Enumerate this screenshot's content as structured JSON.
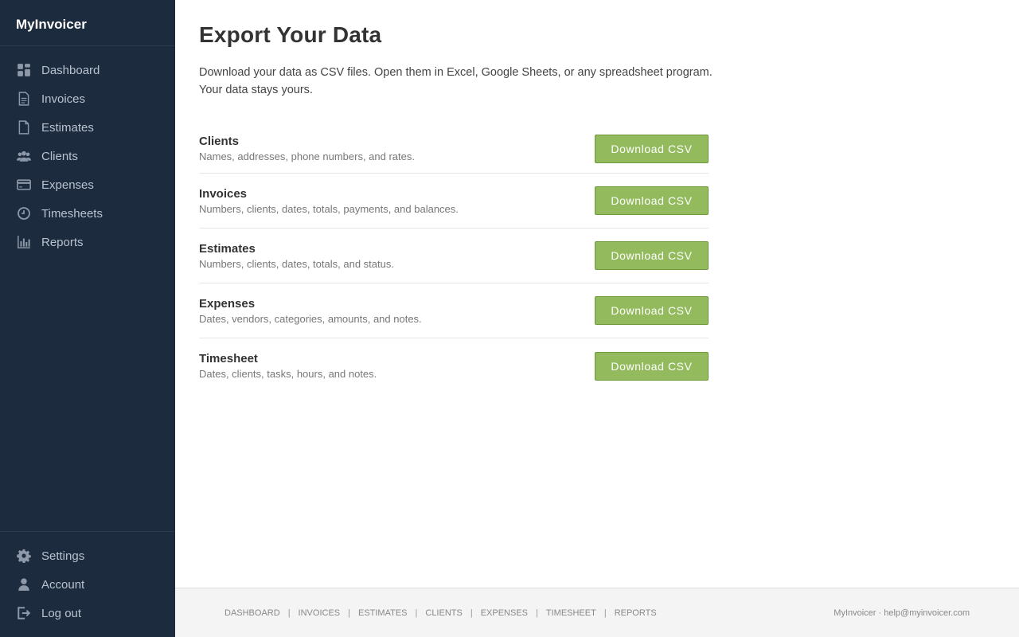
{
  "app": {
    "brand": "MyInvoicer"
  },
  "sidebar": {
    "items": [
      {
        "label": "Dashboard",
        "icon": "dashboard-icon"
      },
      {
        "label": "Invoices",
        "icon": "invoice-icon"
      },
      {
        "label": "Estimates",
        "icon": "estimate-icon"
      },
      {
        "label": "Clients",
        "icon": "clients-icon"
      },
      {
        "label": "Expenses",
        "icon": "credit-card-icon"
      },
      {
        "label": "Timesheets",
        "icon": "clock-icon"
      },
      {
        "label": "Reports",
        "icon": "bar-chart-icon"
      }
    ],
    "bottom_items": [
      {
        "label": "Settings",
        "icon": "gear-icon"
      },
      {
        "label": "Account",
        "icon": "user-icon"
      },
      {
        "label": "Log out",
        "icon": "logout-icon"
      }
    ]
  },
  "main": {
    "title": "Export Your Data",
    "intro_line1": "Download your data as CSV files. Open them in Excel, Google Sheets, or any spreadsheet program.",
    "intro_line2": "Your data stays yours.",
    "exports": [
      {
        "name": "Clients",
        "description": "Names, addresses, phone numbers, and rates.",
        "button": "Download CSV"
      },
      {
        "name": "Invoices",
        "description": "Numbers, clients, dates, totals, payments, and balances.",
        "button": "Download CSV"
      },
      {
        "name": "Estimates",
        "description": "Numbers, clients, dates, totals, and status.",
        "button": "Download CSV"
      },
      {
        "name": "Expenses",
        "description": "Dates, vendors, categories, amounts, and notes.",
        "button": "Download CSV"
      },
      {
        "name": "Timesheet",
        "description": "Dates, clients, tasks, hours, and notes.",
        "button": "Download CSV"
      }
    ]
  },
  "footer": {
    "links": [
      "DASHBOARD",
      "INVOICES",
      "ESTIMATES",
      "CLIENTS",
      "EXPENSES",
      "TIMESHEET",
      "REPORTS"
    ],
    "separator": "|",
    "right_text": "MyInvoicer · help@myinvoicer.com"
  },
  "colors": {
    "sidebar_bg": "#1d2b3f",
    "button_green": "#93bb5d",
    "footer_bg": "#f4f4f4"
  }
}
